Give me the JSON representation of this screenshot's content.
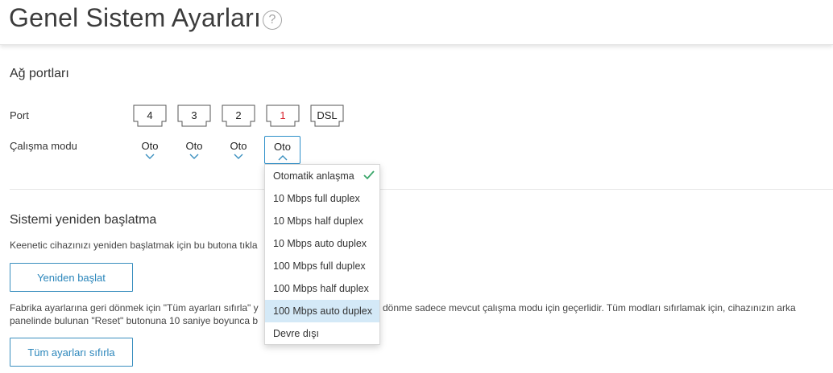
{
  "header": {
    "title": "Genel Sistem Ayarları",
    "help_glyph": "?"
  },
  "ports_section": {
    "title": "Ağ portları",
    "port_label": "Port",
    "mode_label": "Çalışma modu",
    "ports": [
      {
        "label": "4",
        "mode": "Oto"
      },
      {
        "label": "3",
        "mode": "Oto"
      },
      {
        "label": "2",
        "mode": "Oto"
      },
      {
        "label": "1",
        "mode": "Oto"
      },
      {
        "label": "DSL"
      }
    ],
    "dropdown": {
      "selected": "Otomatik anlaşma",
      "highlighted": "100 Mbps auto duplex",
      "options": [
        "Otomatik anlaşma",
        "10 Mbps full duplex",
        "10 Mbps half duplex",
        "10 Mbps auto duplex",
        "100 Mbps full duplex",
        "100 Mbps half duplex",
        "100 Mbps auto duplex",
        "Devre dışı"
      ]
    }
  },
  "restart_section": {
    "title": "Sistemi yeniden başlatma",
    "description": "Keenetic cihazınızı yeniden başlatmak için bu butona tıkla",
    "restart_button": "Yeniden başlat",
    "reset_description_line1_left": "Fabrika ayarlarına geri dönmek için \"Tüm ayarları sıfırla\" y",
    "reset_description_line1_right": "dönme sadece mevcut çalışma modu için geçerlidir. Tüm modları sıfırlamak için, cihazınızın arka",
    "reset_description_line2": "panelinde bulunan \"Reset\" butonuna 10 saniye boyunca b",
    "reset_button": "Tüm ayarları sıfırla"
  },
  "colors": {
    "accent": "#2b86bb",
    "port_1": "#d9232d",
    "check": "#3aa66a",
    "highlight": "#d4e9f7"
  }
}
